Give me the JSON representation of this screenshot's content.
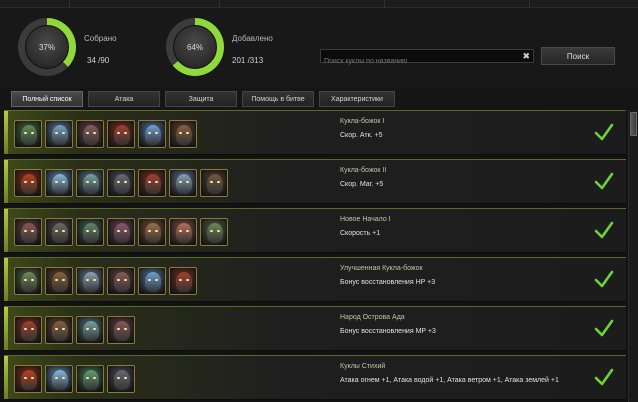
{
  "stats": {
    "collected": {
      "label": "Собрано",
      "percent_text": "37%",
      "percent": 37,
      "count": "34 /90"
    },
    "added": {
      "label": "Добавлено",
      "percent_text": "64%",
      "percent": 64,
      "count": "201 /313"
    }
  },
  "search": {
    "placeholder": "Поиск куклы по названию",
    "value": "",
    "clear_icon": "✖",
    "button_label": "Поиск"
  },
  "tabs": [
    {
      "label": "Полный список",
      "active": true
    },
    {
      "label": "Атака",
      "active": false
    },
    {
      "label": "Защита",
      "active": false
    },
    {
      "label": "Помощь в битве",
      "active": false
    },
    {
      "label": "Характеристики",
      "active": false
    }
  ],
  "colors": {
    "ring_fill": "#8fd93a",
    "ring_track": "#3b3b3b",
    "check": "#6fd23a",
    "row_accent": "#b5c94a"
  },
  "sets": [
    {
      "title": "Кукла-божок I",
      "bonus": "Скор. Атк. +5",
      "complete": true,
      "icons": [
        "#3f5d3a",
        "#4d6d86",
        "#5a3c3c",
        "#6b2a20",
        "#4a6a8e",
        "#5a3f2a"
      ]
    },
    {
      "title": "Кукла-божок II",
      "bonus": "Скор. Маг. +5",
      "complete": true,
      "icons": [
        "#7a2a15",
        "#5a7a94",
        "#4e6b6e",
        "#45454e",
        "#6b2a20",
        "#5a6a7e",
        "#4a3a2a"
      ]
    },
    {
      "title": "Новое Начало I",
      "bonus": "Скорость +1",
      "complete": true,
      "icons": [
        "#5a3a3a",
        "#4a4540",
        "#3e5a48",
        "#5a3a48",
        "#6a4a30",
        "#7a4a3a",
        "#4a5a3a"
      ]
    },
    {
      "title": "Улучшенная Кукла-божок",
      "bonus": "Бонус восстановления HP +3",
      "complete": true,
      "icons": [
        "#4a5a3a",
        "#5a3f2a",
        "#5e6a7a",
        "#5a3c3c",
        "#4a6a8e",
        "#6b2a20"
      ]
    },
    {
      "title": "Народ Острова Ада",
      "bonus": "Бонус восстановления MP +3",
      "complete": true,
      "icons": [
        "#6b2a20",
        "#5a3f2a",
        "#4e6b6e",
        "#5a3a3a"
      ]
    },
    {
      "title": "Куклы Стихий",
      "bonus": "Атака огнем +1, Атака водой +1, Атака ветром +1, Атака землей +1",
      "complete": true,
      "icons": [
        "#7a2a15",
        "#5a7a94",
        "#3e6a4a",
        "#45454e"
      ]
    }
  ]
}
